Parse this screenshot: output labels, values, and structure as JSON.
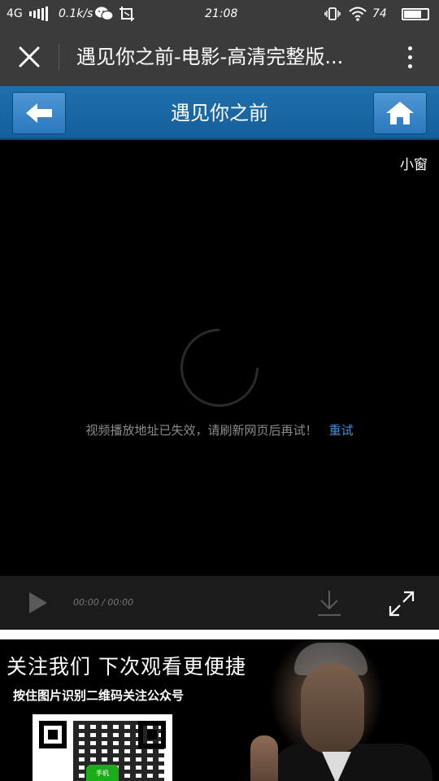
{
  "status_bar": {
    "network": "4G",
    "speed": "0.1k/s",
    "time": "21:08",
    "battery_percent": "74",
    "battery_level": 0.74
  },
  "browser": {
    "page_title": "遇见你之前-电影-高清完整版..."
  },
  "site_nav": {
    "title": "遇见你之前"
  },
  "player": {
    "mini_window_label": "小窗",
    "error_message": "视频播放地址已失效，请刷新网页后再试！",
    "retry_label": "重试",
    "time_display": "00:00 / 00:00"
  },
  "banner": {
    "title": "关注我们 下次观看更便捷",
    "subtitle": "按住图片识别二维码关注公众号",
    "qr_badge": "手机"
  },
  "colors": {
    "chrome": "#3b3b3b",
    "nav_blue": "#1f6fae",
    "link_blue": "#3d8fe0",
    "player_bg": "#000000"
  },
  "icons": [
    "signal-icon",
    "wechat-icon",
    "screenshot-icon",
    "vibrate-icon",
    "wifi-icon",
    "battery-icon",
    "close-icon",
    "more-icon",
    "back-arrow-icon",
    "home-icon",
    "play-icon",
    "download-icon",
    "fullscreen-icon"
  ]
}
